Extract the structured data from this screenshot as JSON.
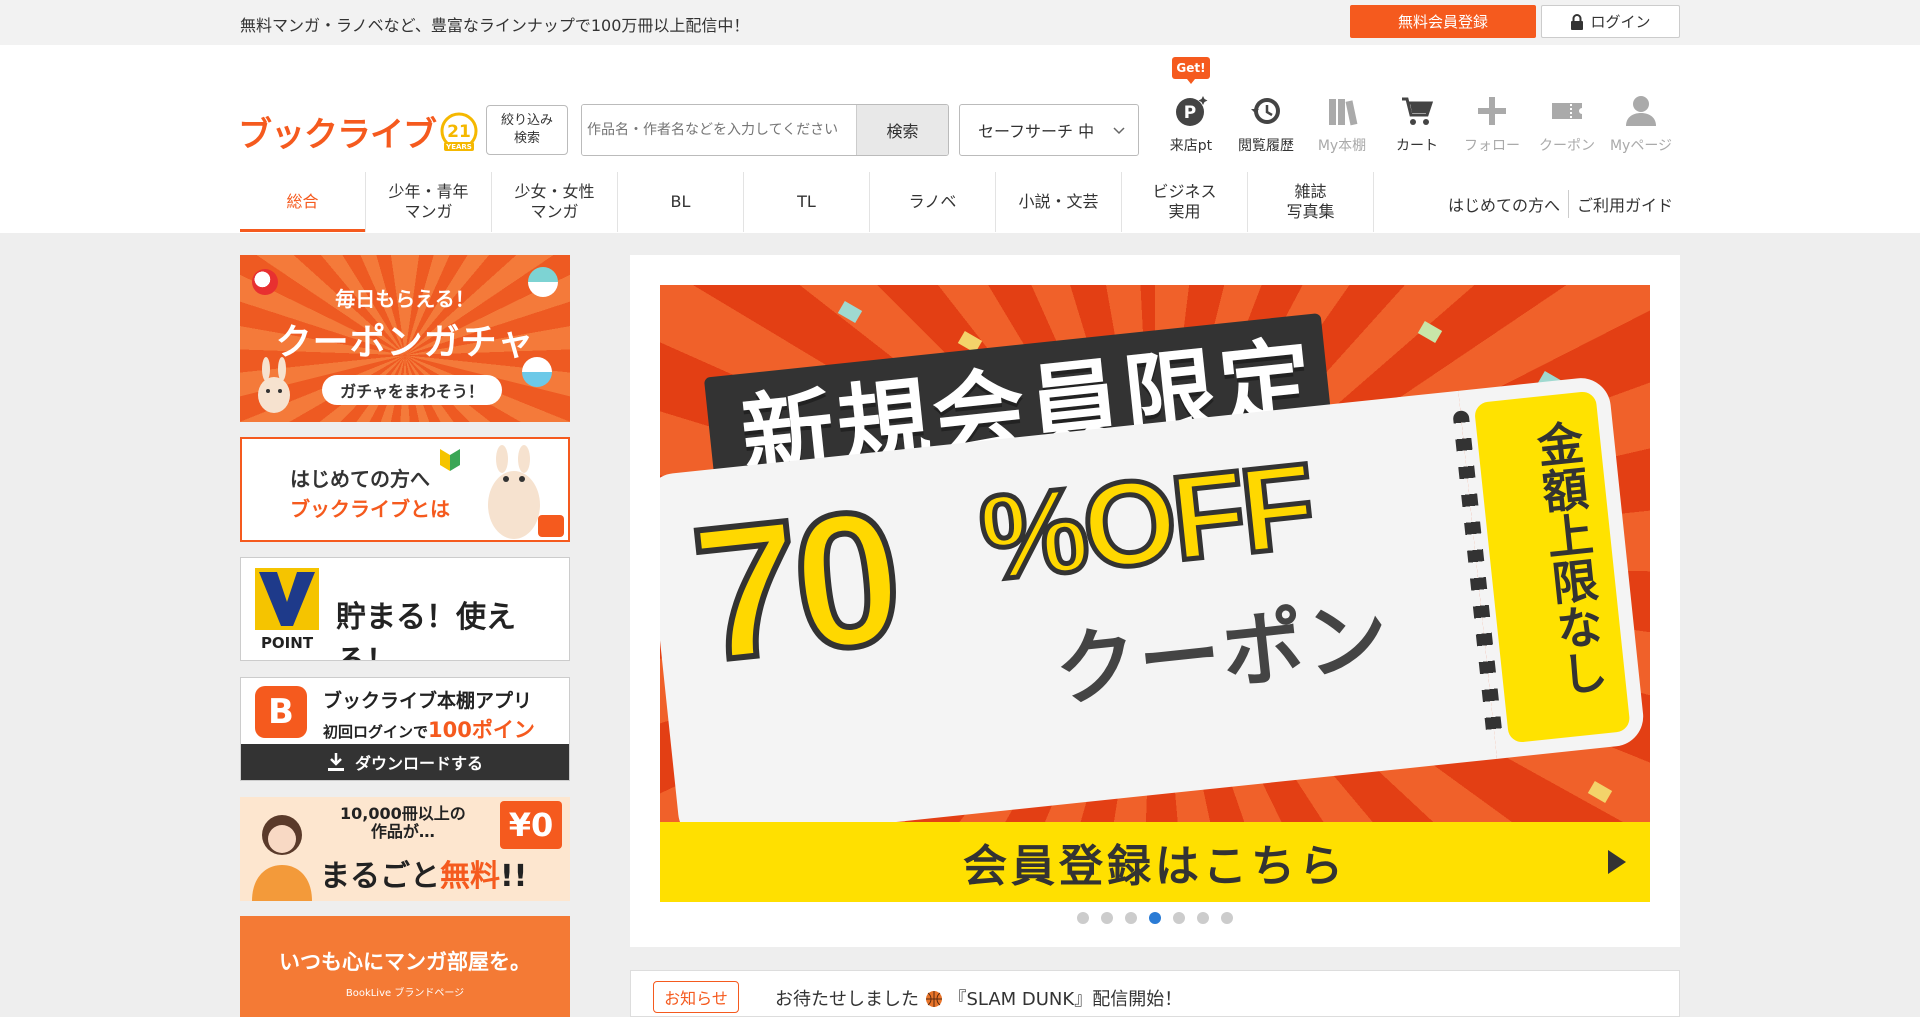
{
  "topbar": {
    "tagline": "無料マンガ・ラノベなど、豊富なラインナップで100万冊以上配信中！",
    "register_label": "無料会員登録",
    "login_label": "ログイン"
  },
  "header": {
    "logo_text": "ブックライブ",
    "logo_badge": "21",
    "logo_badge_sub": "YEARS",
    "refine_label_1": "絞り込み",
    "refine_label_2": "検索",
    "search_placeholder": "作品名・作者名などを入力してください",
    "search_button": "検索",
    "safe_search": "セーフサーチ 中",
    "get_badge": "Get!",
    "icons": [
      {
        "label": "来店pt",
        "icon": "point-icon"
      },
      {
        "label": "閲覧履歴",
        "icon": "history-icon"
      },
      {
        "label": "My本棚",
        "icon": "bookshelf-icon"
      },
      {
        "label": "カート",
        "icon": "cart-icon"
      },
      {
        "label": "フォロー",
        "icon": "plus-icon"
      },
      {
        "label": "クーポン",
        "icon": "coupon-icon"
      },
      {
        "label": "Myページ",
        "icon": "user-icon"
      }
    ]
  },
  "nav": {
    "items": [
      {
        "l1": "総合",
        "l2": ""
      },
      {
        "l1": "少年・青年",
        "l2": "マンガ"
      },
      {
        "l1": "少女・女性",
        "l2": "マンガ"
      },
      {
        "l1": "BL",
        "l2": ""
      },
      {
        "l1": "TL",
        "l2": ""
      },
      {
        "l1": "ラノベ",
        "l2": ""
      },
      {
        "l1": "小説・文芸",
        "l2": ""
      },
      {
        "l1": "ビジネス",
        "l2": "実用"
      },
      {
        "l1": "雑誌",
        "l2": "写真集"
      }
    ],
    "first_time": "はじめての方へ",
    "guide": "ご利用ガイド"
  },
  "sidebar": {
    "gacha": {
      "line1": "毎日もらえる！",
      "line2": "クーポンガチャ",
      "pill": "ガチャをまわそう！"
    },
    "intro": {
      "line1": "はじめての方へ",
      "line2": "ブックライブとは"
    },
    "vpoint": {
      "logo": "POINT",
      "text": "貯まる！使える！"
    },
    "app": {
      "title": "ブックライブ本棚アプリ",
      "sub_a": "初回ログインで",
      "sub_b": "100ポイント",
      "sub_c": "！",
      "download": "ダウンロードする"
    },
    "free": {
      "line1": "10,000冊以上の",
      "line2": "作品が…",
      "big_a": "まるごと",
      "big_b": "無料",
      "big_c": "!!",
      "yen": "¥0"
    },
    "brand": {
      "line1": "いつも心にマンガ部屋を。",
      "line2": "BookLive ブランドページ"
    }
  },
  "hero": {
    "title": "新規会員限定",
    "percent": "70",
    "off": "%OFF",
    "coupon": "クーポン",
    "limit": "金額上限なし",
    "cta": "会員登録はこちら",
    "dots_count": 7,
    "active_dot": 4
  },
  "news": {
    "tag": "お知らせ",
    "text_a": "お待たせしました",
    "text_b": "『SLAM DUNK』配信開始！"
  },
  "colors": {
    "accent": "#f55a1e",
    "yellow": "#ffe000",
    "active_dot": "#2a7bd5"
  }
}
